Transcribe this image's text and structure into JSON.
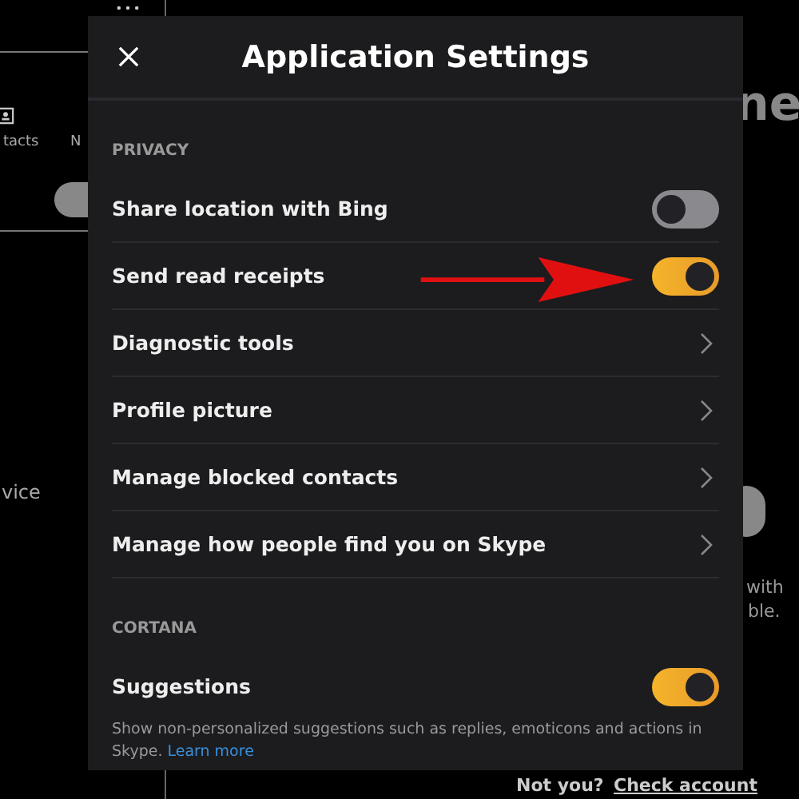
{
  "background": {
    "left_tabs": [
      "tacts",
      "N"
    ],
    "left_text": "vice",
    "right_heading": "ne",
    "right_lines": [
      "with",
      "ble."
    ],
    "footer_text": "Not you?",
    "footer_link": "Check account"
  },
  "dialog": {
    "title": "Application Settings",
    "sections": [
      {
        "heading": "PRIVACY",
        "items": [
          {
            "kind": "toggle",
            "label": "Share location with Bing",
            "on": false
          },
          {
            "kind": "toggle",
            "label": "Send read receipts",
            "on": true
          },
          {
            "kind": "link",
            "label": "Diagnostic tools"
          },
          {
            "kind": "link",
            "label": "Profile picture"
          },
          {
            "kind": "link",
            "label": "Manage blocked contacts"
          },
          {
            "kind": "link",
            "label": "Manage how people find you on Skype"
          }
        ]
      },
      {
        "heading": "CORTANA",
        "items": [
          {
            "kind": "toggle",
            "label": "Suggestions",
            "on": true,
            "note": "Show non-personalized suggestions such as replies, emoticons and actions in Skype.",
            "note_link": "Learn more"
          }
        ]
      }
    ]
  }
}
